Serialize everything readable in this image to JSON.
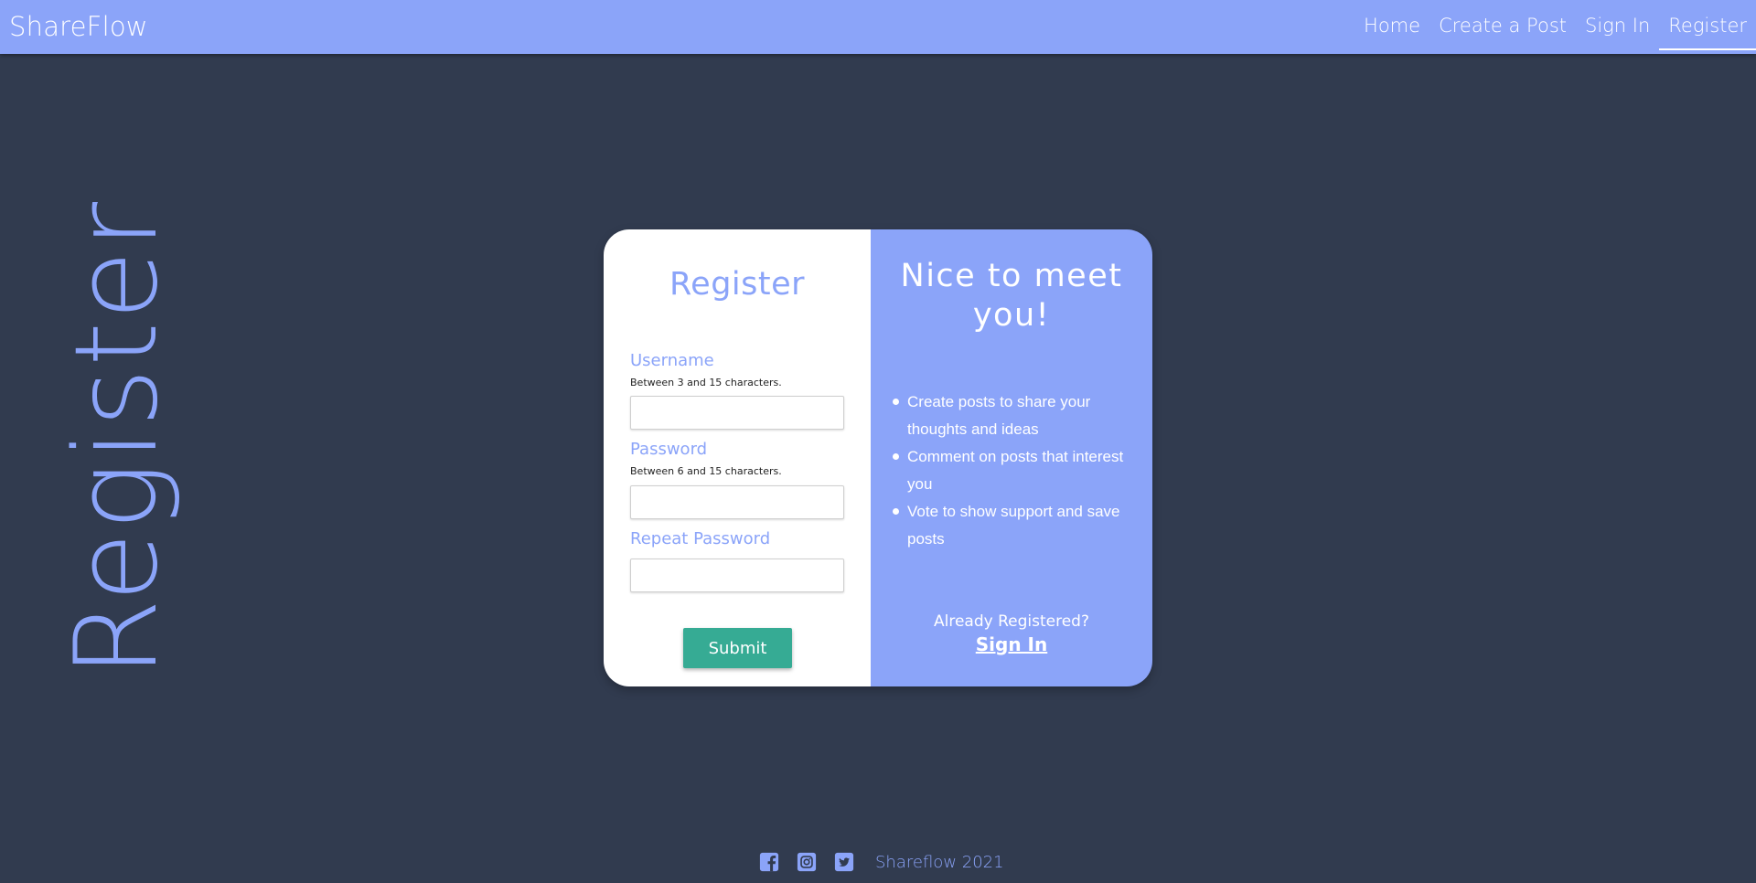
{
  "navbar": {
    "brand": "ShareFlow",
    "links": [
      "Home",
      "Create a Post",
      "Sign In",
      "Register"
    ],
    "active": "Register"
  },
  "page_heading": "Register",
  "form": {
    "title": "Register",
    "username": {
      "label": "Username",
      "hint": "Between 3 and 15 characters.",
      "value": ""
    },
    "password": {
      "label": "Password",
      "hint": "Between 6 and 15 characters.",
      "value": ""
    },
    "repeat_password": {
      "label": "Repeat Password",
      "value": ""
    },
    "submit_label": "Submit"
  },
  "welcome": {
    "title": "Nice to meet you!",
    "benefits": [
      "Create posts to share your thoughts and ideas",
      "Comment on posts that interest you",
      "Vote to show support and save posts"
    ],
    "already_registered": "Already Registered?",
    "signin_label": "Sign In"
  },
  "footer": {
    "icons": [
      "facebook-icon",
      "instagram-icon",
      "twitter-icon"
    ],
    "text": "Shareflow 2021"
  },
  "colors": {
    "accent": "#8ba4f9",
    "background": "#313b4f",
    "submit": "#36ab94",
    "card_left": "#ffffff"
  }
}
